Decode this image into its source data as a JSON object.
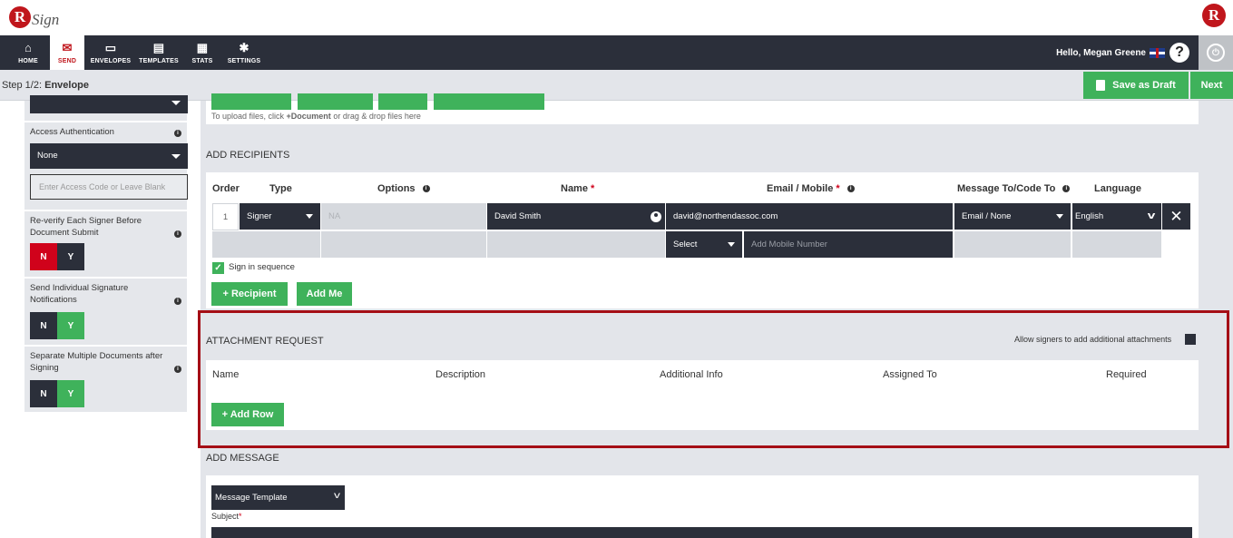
{
  "brand": {
    "logo_letter": "R",
    "logo_text": "Sign",
    "right_logo_letter": "R"
  },
  "nav": {
    "items": [
      {
        "label": "HOME",
        "icon": "home-icon"
      },
      {
        "label": "SEND",
        "icon": "envelope-icon",
        "active": true
      },
      {
        "label": "ENVELOPES",
        "icon": "inbox-icon"
      },
      {
        "label": "TEMPLATES",
        "icon": "templates-icon"
      },
      {
        "label": "STATS",
        "icon": "stats-icon"
      },
      {
        "label": "SETTINGS",
        "icon": "gear-icon"
      }
    ],
    "greeting": "Hello, Megan Greene",
    "help_glyph": "?",
    "power_glyph": "⏻"
  },
  "stepbar": {
    "step_prefix": "Step 1/2:",
    "step_name": "Envelope",
    "save_draft_label": "Save as Draft",
    "next_label": "Next"
  },
  "sidebar": {
    "access_auth_label": "Access Authentication",
    "access_auth_value": "None",
    "access_code_placeholder": "Enter Access Code or Leave Blank",
    "reverify_label": "Re-verify Each Signer Before Document Submit",
    "reverify": {
      "n": "N",
      "y": "Y"
    },
    "individual_notif_label": "Send Individual Signature Notifications",
    "individual_notif": {
      "n": "N",
      "y": "Y"
    },
    "separate_docs_label": "Separate Multiple Documents after Signing",
    "separate_docs": {
      "n": "N",
      "y": "Y"
    },
    "info_glyph": "i"
  },
  "upload": {
    "hint_prefix": "To upload files, click ",
    "hint_bold": "+Document",
    "hint_suffix": " or drag & drop files here"
  },
  "recipients": {
    "section_title": "ADD RECIPIENTS",
    "headers": {
      "order": "Order",
      "type": "Type",
      "options": "Options",
      "name": "Name",
      "email": "Email / Mobile",
      "message": "Message To/Code To",
      "language": "Language",
      "required_mark": "*"
    },
    "row": {
      "order": "1",
      "type": "Signer",
      "options": "NA",
      "name": "David Smith",
      "email": "david@northendassoc.com",
      "message": "Email / None",
      "language": "English",
      "mobile_select": "Select",
      "mobile_placeholder": "Add Mobile Number"
    },
    "sign_in_sequence": "Sign in sequence",
    "add_recipient_label": "+ Recipient",
    "add_me_label": "Add Me"
  },
  "attachments": {
    "section_title": "ATTACHMENT REQUEST",
    "allow_additional_label": "Allow signers to add additional attachments",
    "headers": {
      "name": "Name",
      "description": "Description",
      "additional_info": "Additional Info",
      "assigned_to": "Assigned To",
      "required": "Required"
    },
    "add_row_label": "+ Add Row"
  },
  "message": {
    "section_title": "ADD MESSAGE",
    "template_select": "Message Template",
    "subject_label": "Subject",
    "required_mark": "*"
  },
  "colors": {
    "nav_bg": "#2b2f3a",
    "accent_green": "#3fb25b",
    "brand_red": "#c0161c",
    "highlight_border": "#a50e16"
  }
}
